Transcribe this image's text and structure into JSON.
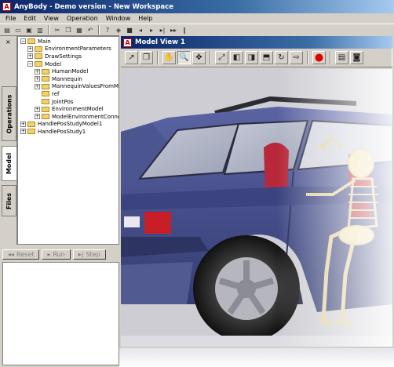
{
  "app": {
    "title": "AnyBody - Demo version - New Workspace",
    "icon_letter": "A"
  },
  "menu": [
    "File",
    "Edit",
    "View",
    "Operation",
    "Window",
    "Help"
  ],
  "side_tabs": {
    "operations": "Operations",
    "model": "Model",
    "files": "Files",
    "close": "×"
  },
  "tree": [
    {
      "label": "Main",
      "depth": 0,
      "expander": "−"
    },
    {
      "label": "EnvironmentParameters",
      "depth": 1,
      "expander": "+"
    },
    {
      "label": "DrawSettings",
      "depth": 1,
      "expander": "+"
    },
    {
      "label": "Model",
      "depth": 1,
      "expander": "−"
    },
    {
      "label": "HumanModel",
      "depth": 2,
      "expander": "+"
    },
    {
      "label": "Mannequin",
      "depth": 2,
      "expander": "+"
    },
    {
      "label": "MannequinValuesFromModel",
      "depth": 2,
      "expander": "+"
    },
    {
      "label": "ref",
      "depth": 2,
      "expander": ""
    },
    {
      "label": "JointPos",
      "depth": 2,
      "expander": ""
    },
    {
      "label": "EnvironmentModel",
      "depth": 2,
      "expander": "+"
    },
    {
      "label": "ModelEnvironmentConnection",
      "depth": 2,
      "expander": "+"
    },
    {
      "label": "HandlePosStudyModel1",
      "depth": 0,
      "expander": "+"
    },
    {
      "label": "HandlePosStudy1",
      "depth": 0,
      "expander": "+"
    }
  ],
  "run_buttons": {
    "reset": "Reset",
    "run": "Run",
    "step": "Step"
  },
  "model_view": {
    "title": "Model View 1",
    "icon_letter": "A"
  },
  "colors": {
    "titlebar": "#0a246a",
    "car_body": "#46508c",
    "taillight": "#c81e28",
    "skeleton": "#f0e2b4"
  }
}
